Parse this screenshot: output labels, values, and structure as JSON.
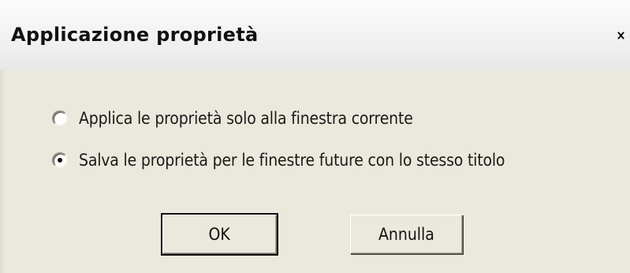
{
  "dialog": {
    "title": "Applicazione proprietà",
    "close_icon": "close-icon"
  },
  "options": [
    {
      "label": "Applica le proprietà solo alla finestra corrente",
      "selected": false
    },
    {
      "label": "Salva le proprietà per le finestre future con lo stesso titolo",
      "selected": true
    }
  ],
  "buttons": {
    "ok_label": "OK",
    "cancel_label": "Annulla"
  }
}
